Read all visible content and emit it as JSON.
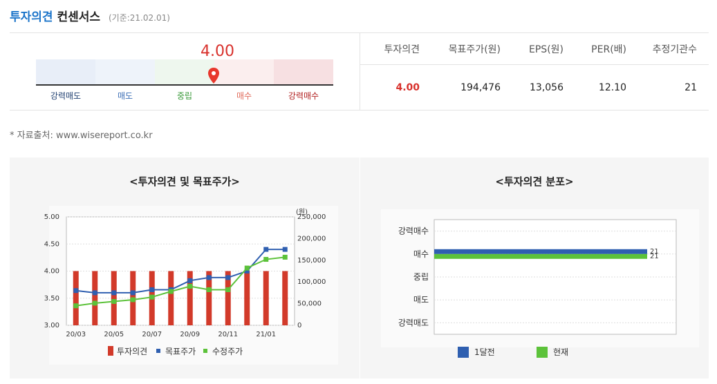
{
  "header": {
    "title_blue": "투자의견",
    "title_dark": "컨센서스",
    "basis": "(기준:21.02.01)"
  },
  "gauge": {
    "value": "4.00",
    "labels": [
      "강력매도",
      "매도",
      "중립",
      "매수",
      "강력매수"
    ],
    "label_colors": [
      "#1f3f70",
      "#3a6db5",
      "#3a9a3a",
      "#e06a5a",
      "#b01e1e"
    ],
    "segment_colors": [
      "#e8eef8",
      "#eef3fa",
      "#eef7ee",
      "#fbeeee",
      "#f7e0e2"
    ],
    "pin_color": "#e8372c"
  },
  "summary_table": {
    "headers": [
      "투자의견",
      "목표주가(원)",
      "EPS(원)",
      "PER(배)",
      "추정기관수"
    ],
    "values": [
      "4.00",
      "194,476",
      "13,056",
      "12.10",
      "21"
    ]
  },
  "source_note": "* 자료출처: www.wisereport.co.kr",
  "chart_data": [
    {
      "type": "bar",
      "title": "<투자의견 및 목표주가>",
      "categories": [
        "20/03",
        "20/04",
        "20/05",
        "20/06",
        "20/07",
        "20/08",
        "20/09",
        "20/10",
        "20/11",
        "20/12",
        "21/01",
        "21/02"
      ],
      "x_tick_labels": [
        "20/03",
        "20/05",
        "20/07",
        "20/09",
        "20/11",
        "21/01"
      ],
      "y_left": {
        "ylim": [
          3.0,
          5.0
        ],
        "ticks": [
          "3.00",
          "3.50",
          "4.00",
          "4.50",
          "5.00"
        ]
      },
      "y_right": {
        "label": "(원)",
        "ylim": [
          0,
          250000
        ],
        "ticks": [
          "0",
          "50,000",
          "100,000",
          "150,000",
          "200,000",
          "250,000"
        ]
      },
      "series": [
        {
          "name": "투자의견",
          "kind": "bar",
          "axis": "left",
          "color": "#d23a2a",
          "values": [
            4,
            4,
            4,
            4,
            4,
            4,
            4,
            4,
            4,
            4,
            4,
            4
          ]
        },
        {
          "name": "목표주가",
          "kind": "line",
          "axis": "right",
          "color": "#2f5fb0",
          "values": [
            80000,
            75000,
            75000,
            75000,
            82000,
            82000,
            103000,
            110000,
            110000,
            125000,
            175000,
            175000
          ]
        },
        {
          "name": "수정주가",
          "kind": "line",
          "axis": "right",
          "color": "#5cc23a",
          "values": [
            45000,
            51000,
            55000,
            59000,
            65000,
            78000,
            90000,
            82000,
            82000,
            132000,
            152000,
            157000
          ]
        }
      ]
    },
    {
      "type": "bar",
      "orientation": "horizontal",
      "title": "<투자의견 분포>",
      "categories": [
        "강력매수",
        "매수",
        "중립",
        "매도",
        "강력매도"
      ],
      "series": [
        {
          "name": "1달전",
          "color": "#2f5fb0",
          "values": [
            0,
            21,
            0,
            0,
            0
          ]
        },
        {
          "name": "현재",
          "color": "#5cc23a",
          "values": [
            0,
            21,
            0,
            0,
            0
          ]
        }
      ],
      "data_labels": [
        "21",
        "21"
      ]
    }
  ]
}
